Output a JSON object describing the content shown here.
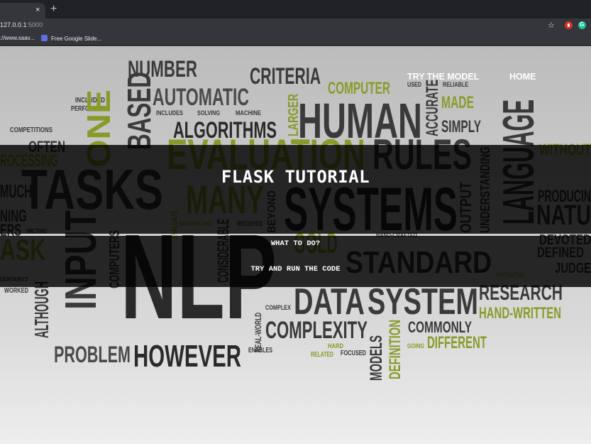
{
  "browser": {
    "tab_close_glyph": "×",
    "new_tab_glyph": "+",
    "address_host": "127.0.0.1",
    "address_port": ":5000",
    "star_icon": "star-icon",
    "bookmarks": [
      {
        "label": "://www.saav..."
      },
      {
        "label": "Free Google Slide..."
      }
    ]
  },
  "nav": {
    "try_model": "TRY THE MODEL",
    "home": "HOME"
  },
  "hero": {
    "title": "FLASK TUTORIAL",
    "what_to_do": "WHAT TO DO?",
    "try_code": "TRY AND RUN THE CODE"
  },
  "colors": {
    "accent_green": "#8a9a2a",
    "word_dark": "#333333"
  }
}
